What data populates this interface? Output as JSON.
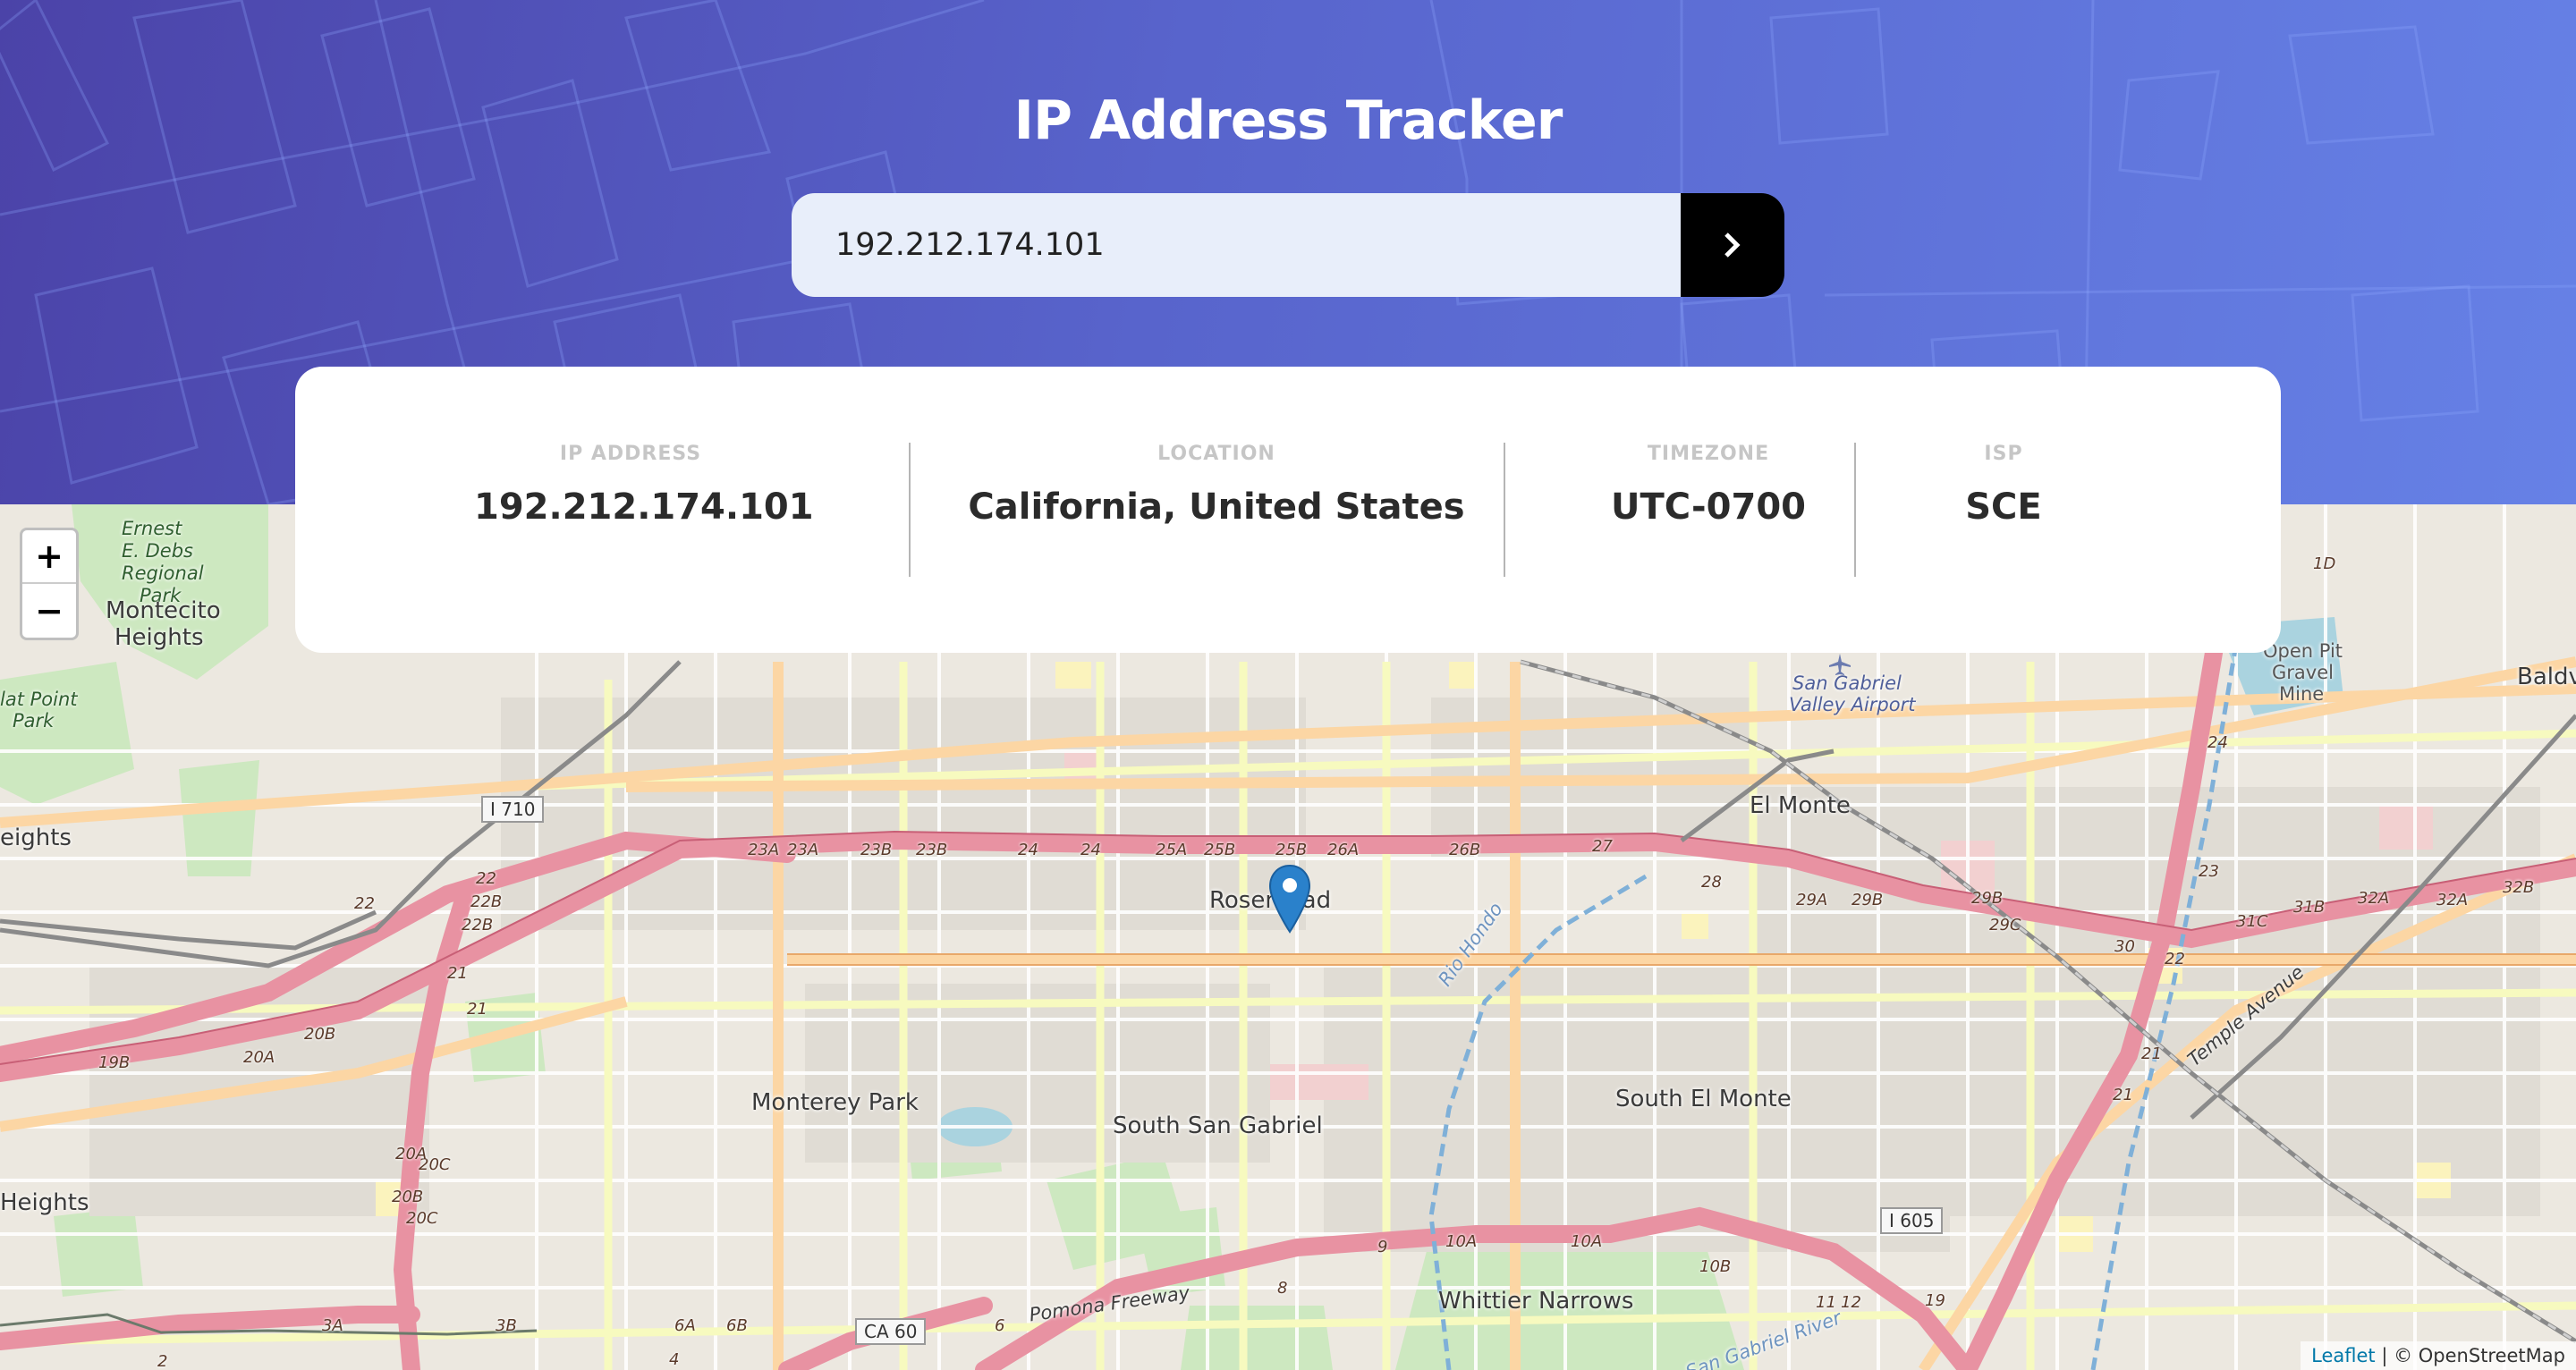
{
  "header": {
    "title": "IP Address Tracker"
  },
  "search": {
    "value": "192.212.174.101",
    "submit_icon": "chevron-right-icon"
  },
  "info": {
    "ip_label": "IP ADDRESS",
    "ip_value": "192.212.174.101",
    "location_label": "LOCATION",
    "location_value": "California, United States",
    "timezone_label": "TIMEZONE",
    "timezone_value": "UTC-0700",
    "isp_label": "ISP",
    "isp_value": "SCE"
  },
  "map": {
    "zoom_in": "+",
    "zoom_out": "−",
    "attribution_link": "Leaflet",
    "attribution_text": "| © OpenStreetMap",
    "marker_icon": "map-marker-icon",
    "places": {
      "rosemead": "Rosemead",
      "el_monte": "El Monte",
      "monterey_park": "Monterey Park",
      "south_san_gabriel": "South San Gabriel",
      "south_el_monte": "South El Monte",
      "whittier_narrows": "Whittier Narrows",
      "montecito_heights_1": "Montecito",
      "montecito_heights_2": "Heights",
      "heights_left": "eights",
      "heights_left_2": "Heights",
      "baldwin": "Baldv",
      "ernest_1": "Ernest",
      "ernest_2": "E. Debs",
      "ernest_3": "Regional",
      "ernest_4": "Park",
      "flat_point_1": "lat Point",
      "flat_point_2": "Park",
      "airport_1": "San Gabriel",
      "airport_2": "Valley Airport",
      "mine_1": "Open Pit",
      "mine_2": "Gravel",
      "mine_3": "Mine",
      "pomona_fwy": "Pomona Freeway",
      "temple_ave": "Temple Avenue",
      "rio_hondo": "Rio Hondo",
      "san_gabriel_river": "San Gabriel River"
    },
    "shields": {
      "i710": "I 710",
      "i605": "I 605",
      "ca60": "CA 60"
    },
    "exits": [
      "23A",
      "23A",
      "23B",
      "23B",
      "24",
      "24",
      "25A",
      "25B",
      "25B",
      "26A",
      "26B",
      "27",
      "28",
      "29A",
      "29B",
      "29B",
      "29C",
      "30",
      "31C",
      "31B",
      "32A",
      "32A",
      "32B",
      "22B",
      "22B",
      "22",
      "22",
      "21",
      "21",
      "21",
      "20B",
      "20A",
      "19B",
      "20C",
      "20C",
      "20B",
      "20A",
      "3A",
      "3B",
      "4",
      "6A",
      "6B",
      "6",
      "8",
      "9",
      "10A",
      "10A",
      "10B",
      "11",
      "12",
      "19",
      "21",
      "22",
      "23",
      "24",
      "1D",
      "2"
    ]
  }
}
